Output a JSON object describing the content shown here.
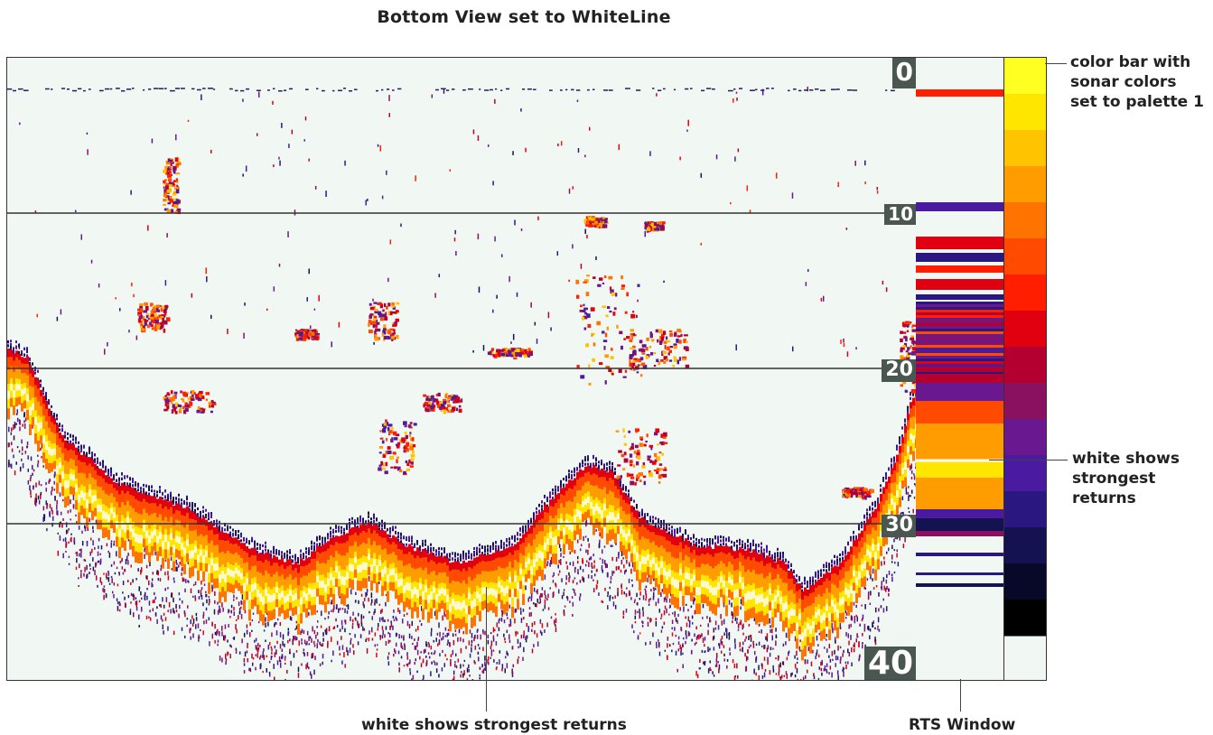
{
  "title": "Bottom View set to WhiteLine",
  "depth_scale": [
    "0",
    "10",
    "20",
    "30",
    "40"
  ],
  "annotations": {
    "color_bar": "color bar with sonar colors set to palette 1",
    "color_bar_lines": [
      "color bar with",
      "sonar colors",
      "set to palette 1"
    ],
    "white_right_lines": [
      "white shows",
      "strongest",
      "returns"
    ],
    "white_bottom": "white shows strongest returns",
    "rts": "RTS Window"
  },
  "palette": [
    "#ffff22",
    "#ffe600",
    "#ffc400",
    "#ff9c00",
    "#ff7400",
    "#ff4a00",
    "#ff1e00",
    "#e00010",
    "#b40030",
    "#8a1060",
    "#6a1890",
    "#4a1aa0",
    "#2a1880",
    "#141250",
    "#080828",
    "#000000"
  ],
  "colors": {
    "background": "#f1f8f3",
    "gridline": "#333333",
    "label_bg": "#4a5650"
  }
}
